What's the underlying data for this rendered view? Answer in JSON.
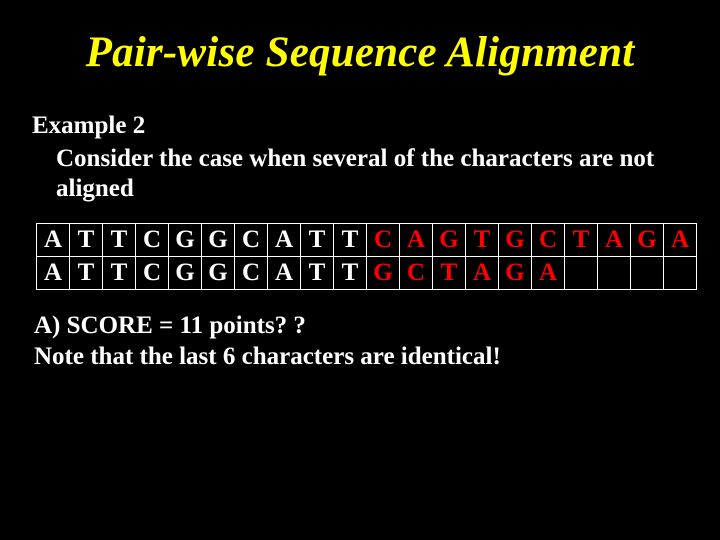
{
  "title": "Pair-wise Sequence Alignment",
  "example_label": "Example 2",
  "example_text": "Consider the case when several of the characters are not aligned",
  "rows": [
    [
      {
        "c": "A",
        "cls": "w"
      },
      {
        "c": "T",
        "cls": "w"
      },
      {
        "c": "T",
        "cls": "w"
      },
      {
        "c": "C",
        "cls": "w"
      },
      {
        "c": "G",
        "cls": "w"
      },
      {
        "c": "G",
        "cls": "w"
      },
      {
        "c": "C",
        "cls": "w"
      },
      {
        "c": "A",
        "cls": "w"
      },
      {
        "c": "T",
        "cls": "w"
      },
      {
        "c": "T",
        "cls": "w"
      },
      {
        "c": "C",
        "cls": "r"
      },
      {
        "c": "A",
        "cls": "r"
      },
      {
        "c": "G",
        "cls": "r"
      },
      {
        "c": "T",
        "cls": "r"
      },
      {
        "c": "G",
        "cls": "r"
      },
      {
        "c": "C",
        "cls": "r"
      },
      {
        "c": "T",
        "cls": "r"
      },
      {
        "c": "A",
        "cls": "r"
      },
      {
        "c": "G",
        "cls": "r"
      },
      {
        "c": "A",
        "cls": "r"
      }
    ],
    [
      {
        "c": "A",
        "cls": "w"
      },
      {
        "c": "T",
        "cls": "w"
      },
      {
        "c": "T",
        "cls": "w"
      },
      {
        "c": "C",
        "cls": "w"
      },
      {
        "c": "G",
        "cls": "w"
      },
      {
        "c": "G",
        "cls": "w"
      },
      {
        "c": "C",
        "cls": "w"
      },
      {
        "c": "A",
        "cls": "w"
      },
      {
        "c": "T",
        "cls": "w"
      },
      {
        "c": "T",
        "cls": "w"
      },
      {
        "c": "G",
        "cls": "r"
      },
      {
        "c": "C",
        "cls": "r"
      },
      {
        "c": "T",
        "cls": "r"
      },
      {
        "c": "A",
        "cls": "r"
      },
      {
        "c": "G",
        "cls": "r"
      },
      {
        "c": "A",
        "cls": "r"
      },
      {
        "c": "",
        "cls": "w"
      },
      {
        "c": "",
        "cls": "w"
      },
      {
        "c": "",
        "cls": "w"
      },
      {
        "c": "",
        "cls": "w"
      }
    ]
  ],
  "score_line": "A) SCORE = 11 points? ?",
  "note_line": "Note that the last 6 characters are identical!"
}
